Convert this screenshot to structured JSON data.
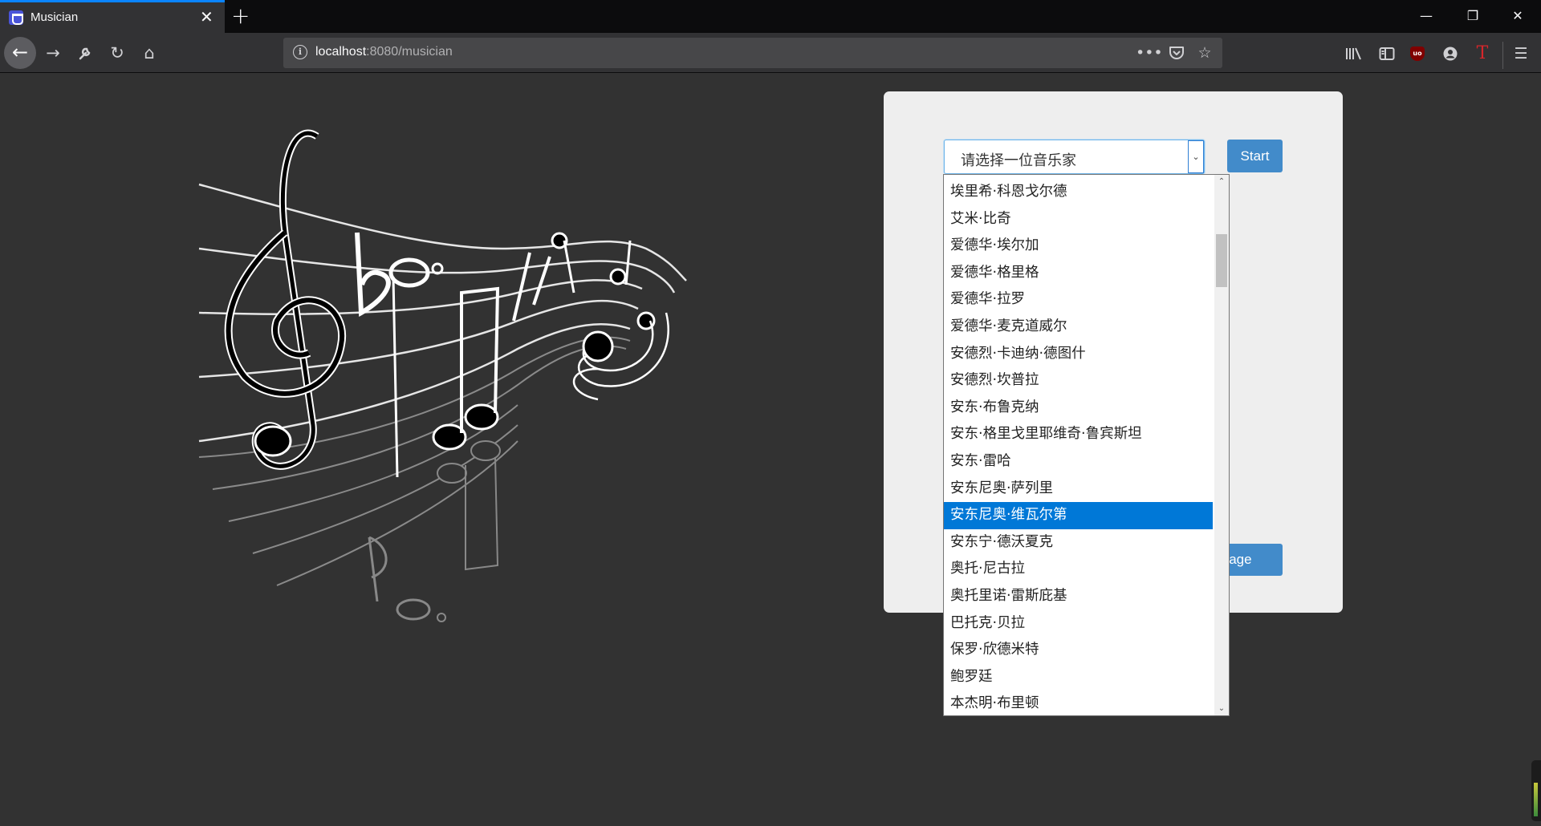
{
  "browser": {
    "tab_title": "Musician",
    "tab_close": "✕",
    "new_tab": "+",
    "url_host": "localhost",
    "url_rest": ":8080/musician"
  },
  "page": {
    "select_placeholder": "请选择一位音乐家",
    "start_button": "Start",
    "page_button": "t Page",
    "selected_index": 12,
    "options": [
      "埃里希·科恩戈尔德",
      "艾米·比奇",
      "爱德华·埃尔加",
      "爱德华·格里格",
      "爱德华·拉罗",
      "爱德华·麦克道威尔",
      "安德烈·卡迪纳·德图什",
      "安德烈·坎普拉",
      "安东·布鲁克纳",
      "安东·格里戈里耶维奇·鲁宾斯坦",
      "安东·雷哈",
      "安东尼奥·萨列里",
      "安东尼奥·维瓦尔第",
      "安东宁·德沃夏克",
      "奥托·尼古拉",
      "奥托里诺·雷斯庇基",
      "巴托克·贝拉",
      "保罗·欣德米特",
      "鲍罗廷",
      "本杰明·布里顿"
    ]
  },
  "colors": {
    "accent": "#0a84ff",
    "button": "#428bca",
    "selected_option": "#0078d7",
    "page_bg": "#323232",
    "panel_bg": "#eeeeee"
  }
}
